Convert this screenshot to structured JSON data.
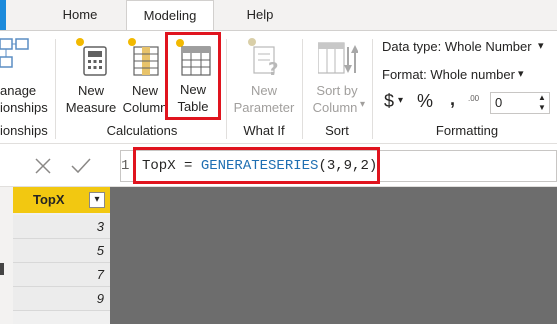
{
  "tabs": [
    {
      "label": "Home"
    },
    {
      "label": "Modeling",
      "active": true
    },
    {
      "label": "Help"
    }
  ],
  "ribbon": {
    "manage_relationships": {
      "line1": "anage",
      "line2": "ionships"
    },
    "relationships_group": "ionships",
    "new_measure": {
      "line1": "New",
      "line2": "Measure"
    },
    "new_column": {
      "line1": "New",
      "line2": "Column"
    },
    "new_table": {
      "line1": "New",
      "line2": "Table"
    },
    "calculations_group": "Calculations",
    "new_parameter": {
      "line1": "New",
      "line2": "Parameter"
    },
    "what_if_group": "What If",
    "sort_by_column": {
      "line1": "Sort by",
      "line2": "Column"
    },
    "sort_group": "Sort",
    "data_type": "Data type: Whole Number",
    "format": "Format: Whole number",
    "currency_symbol": "$",
    "percent_symbol": "%",
    "comma_symbol": ",",
    "decimal_icon_label": ".00",
    "decimal_value": "0",
    "formatting_group": "Formatting"
  },
  "formula": {
    "line_number": "1",
    "text_prefix": "TopX = ",
    "function_name": "GENERATESERIES",
    "args": "(3,9,2)"
  },
  "table": {
    "column_header": "TopX",
    "rows": [
      "3",
      "5",
      "7",
      "9"
    ]
  },
  "colors": {
    "accent_blue": "#1c8adb",
    "header_yellow": "#f2c811",
    "highlight_red": "#e0141e",
    "canvas_gray": "#6d6d6d"
  }
}
